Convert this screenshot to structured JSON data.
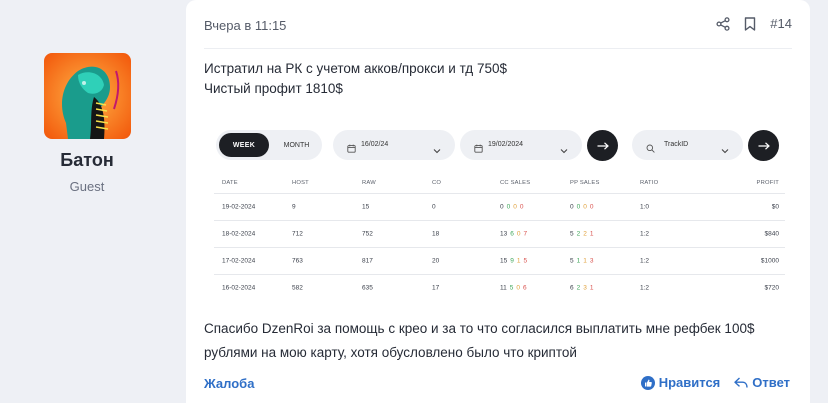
{
  "user": {
    "name": "Батон",
    "title": "Guest"
  },
  "post": {
    "date": "Вчера в 11:15",
    "number": "#14",
    "lines": [
      "Истратил на РК с учетом акков/прокси и тд 750$",
      "Чистый профит 1810$"
    ],
    "footer_lines": [
      "Спасибо DzenRoi за помощь с крео и за то что согласился выплатить мне рефбек 100$",
      "рублями на мою карту, хотя обусловлено было что криптой"
    ],
    "report": "Жалоба",
    "like": "Нравится",
    "reply": "Ответ"
  },
  "stats": {
    "toggle": {
      "active": "WEEK",
      "inactive": "MONTH"
    },
    "date_from": "16/02/24",
    "date_to": "19/02/2024",
    "search": "TrackID",
    "headers": [
      "DATE",
      "HOST",
      "RAW",
      "CO",
      "CC SALES",
      "PP SALES",
      "RATIO",
      "PROFIT"
    ],
    "rows": [
      {
        "date": "19-02-2024",
        "host": "9",
        "raw": "15",
        "co": "0",
        "cc": [
          "0",
          "0",
          "0",
          "0"
        ],
        "pp": [
          "0",
          "0",
          "0",
          "0"
        ],
        "ratio": "1:0",
        "profit": "$0"
      },
      {
        "date": "18-02-2024",
        "host": "712",
        "raw": "752",
        "co": "18",
        "cc": [
          "13",
          "6",
          "0",
          "7"
        ],
        "pp": [
          "5",
          "2",
          "2",
          "1"
        ],
        "ratio": "1:2",
        "profit": "$840"
      },
      {
        "date": "17-02-2024",
        "host": "763",
        "raw": "817",
        "co": "20",
        "cc": [
          "15",
          "9",
          "1",
          "5"
        ],
        "pp": [
          "5",
          "1",
          "1",
          "3"
        ],
        "ratio": "1:2",
        "profit": "$1000"
      },
      {
        "date": "16-02-2024",
        "host": "582",
        "raw": "635",
        "co": "17",
        "cc": [
          "11",
          "5",
          "0",
          "6"
        ],
        "pp": [
          "6",
          "2",
          "3",
          "1"
        ],
        "ratio": "1:2",
        "profit": "$720"
      }
    ],
    "sale_colors": [
      "#3a3f4a",
      "#3fa65a",
      "#e0a03a",
      "#d9534f"
    ]
  },
  "colors": {
    "accent": "#2f6fc7",
    "dark": "#1d1f24"
  }
}
